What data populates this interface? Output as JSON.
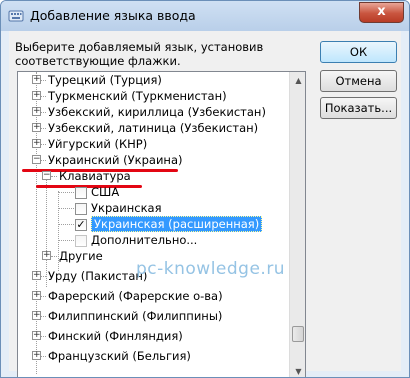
{
  "window": {
    "title": "Добавление языка ввода",
    "close_label": "x"
  },
  "dialog": {
    "prompt": "Выберите добавляемый язык, установив соответствующие флажки."
  },
  "buttons": {
    "ok": "ОК",
    "cancel": "Отмена",
    "show": "Показать..."
  },
  "tree": {
    "items": [
      {
        "label": "Турецкий (Турция)"
      },
      {
        "label": "Туркменский (Туркменистан)"
      },
      {
        "label": "Узбекский, кириллица (Узбекистан)"
      },
      {
        "label": "Узбекский, латиница (Узбекистан)"
      },
      {
        "label": "Уйгурский (КНР)"
      },
      {
        "label": "Украинский (Украина)",
        "expanded": true
      },
      {
        "label": "Клавиатура",
        "expanded": true
      },
      {
        "label": "США",
        "checked": false
      },
      {
        "label": "Украинская",
        "checked": false
      },
      {
        "label": "Украинская (расширенная)",
        "checked": true,
        "selected": true
      },
      {
        "label": "Дополнительно..."
      },
      {
        "label": "Другие"
      },
      {
        "label": "Урду (Пакистан)"
      },
      {
        "label": "Фарерский (Фарерские о-ва)"
      },
      {
        "label": "Филиппинский (Филиппины)"
      },
      {
        "label": "Финский (Финляндия)"
      },
      {
        "label": "Французский (Бельгия)"
      }
    ],
    "scroll_position": 0.82
  },
  "watermark": "pc-knowledge.ru",
  "colors": {
    "selection": "#3399ff",
    "highlight_underline": "#e30613"
  }
}
